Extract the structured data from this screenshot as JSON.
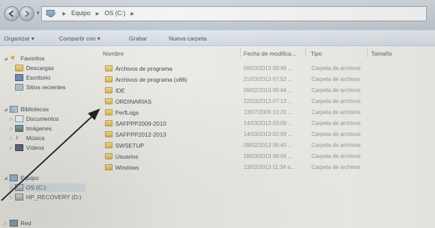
{
  "address": {
    "crumbs": [
      "Equipo",
      "OS (C:)"
    ]
  },
  "toolbar": {
    "organize": "Organizar ▾",
    "share": "Compartir con ▾",
    "burn": "Grabar",
    "new_folder": "Nueva carpeta"
  },
  "nav": {
    "favorites": "Favoritos",
    "downloads": "Descargas",
    "desktop": "Escritorio",
    "recent": "Sitios recientes",
    "libraries": "Bibliotecas",
    "documents": "Documentos",
    "images": "Imágenes",
    "music": "Música",
    "videos": "Vídeos",
    "computer": "Equipo",
    "os_drive": "OS (C:)",
    "recovery": "HP_RECOVERY (D:)",
    "network": "Red"
  },
  "columns": {
    "name": "Nombre",
    "date": "Fecha de modifica...",
    "type": "Tipo",
    "size": "Tamaño"
  },
  "files": [
    {
      "name": "Archivos de programa",
      "date": "09/03/2013 09:49 ...",
      "type": "Carpeta de archivos"
    },
    {
      "name": "Archivos de programa (x86)",
      "date": "21/03/2013 07:52 ...",
      "type": "Carpeta de archivos"
    },
    {
      "name": "IDE",
      "date": "09/02/2013 06:44 ...",
      "type": "Carpeta de archivos"
    },
    {
      "name": "ORDINARIAS",
      "date": "22/03/2013 07:13 ...",
      "type": "Carpeta de archivos"
    },
    {
      "name": "PerfLogs",
      "date": "13/07/2009 10:20 ...",
      "type": "Carpeta de archivos"
    },
    {
      "name": "SAFPPP2009-2010",
      "date": "14/03/2013 03:09 ...",
      "type": "Carpeta de archivos"
    },
    {
      "name": "SAFPPP2012-2013",
      "date": "14/03/2013 02:59 ...",
      "type": "Carpeta de archivos"
    },
    {
      "name": "SWSETUP",
      "date": "09/02/2013 06:40 ...",
      "type": "Carpeta de archivos"
    },
    {
      "name": "Usuarios",
      "date": "28/03/2013 06:56 ...",
      "type": "Carpeta de archivos"
    },
    {
      "name": "Windows",
      "date": "13/02/2013 11:34 a...",
      "type": "Carpeta de archivos"
    }
  ],
  "colors": {
    "selection": "#aac8e1",
    "folder": "#e8c977",
    "arrow": "#1a1d22"
  }
}
